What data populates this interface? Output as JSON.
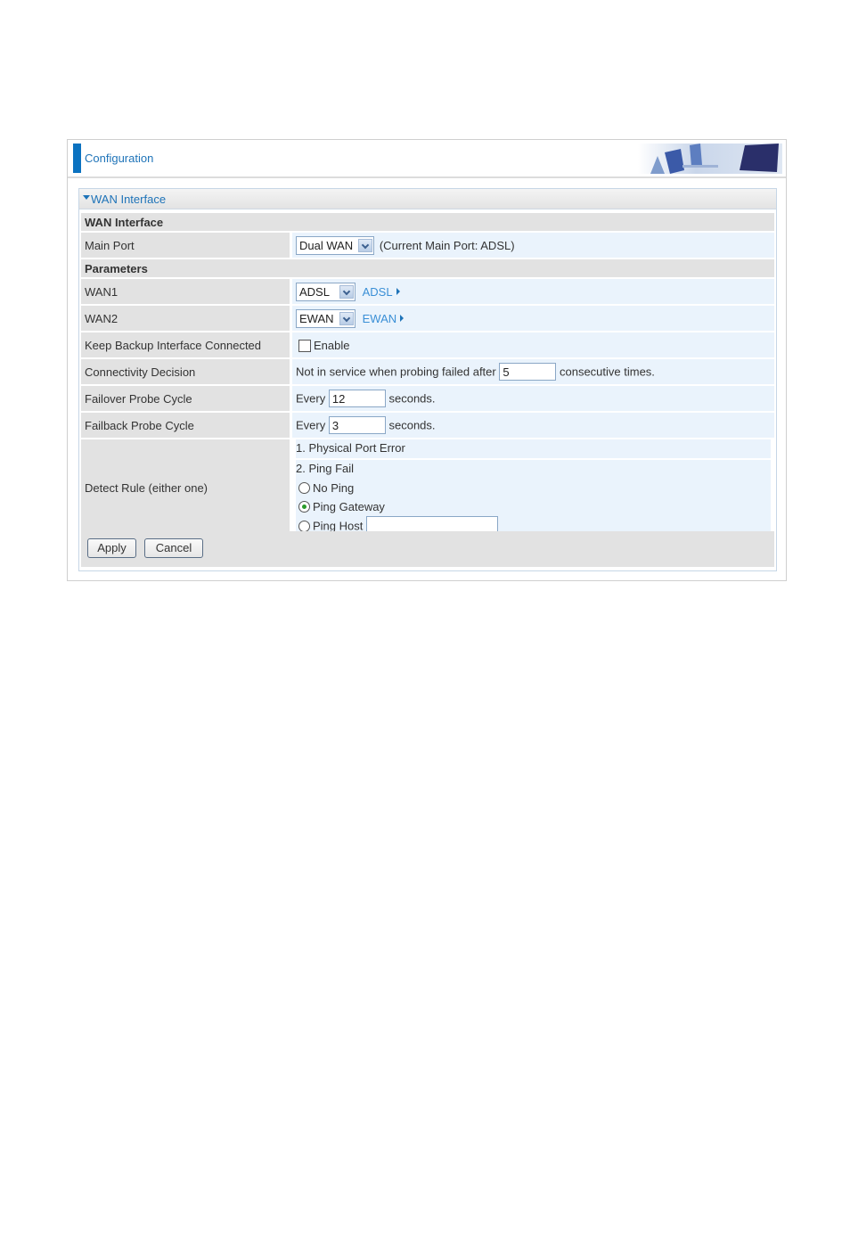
{
  "header": {
    "title": "Configuration",
    "banner_icon": "office-banner-image"
  },
  "panel": {
    "title": "WAN Interface"
  },
  "form": {
    "section1": "WAN Interface",
    "main_port": {
      "label": "Main Port",
      "selected": "Dual WAN",
      "note": "(Current Main Port: ADSL)"
    },
    "section2": "Parameters",
    "wan1": {
      "label": "WAN1",
      "selected": "ADSL",
      "link": "ADSL"
    },
    "wan2": {
      "label": "WAN2",
      "selected": "EWAN",
      "link": "EWAN"
    },
    "keep_backup": {
      "label": "Keep Backup Interface Connected",
      "checkbox_label": "Enable",
      "checked": false
    },
    "connectivity": {
      "label": "Connectivity Decision",
      "prefix": "Not in service when probing failed after",
      "value": "5",
      "suffix": "consecutive times."
    },
    "failover": {
      "label": "Failover Probe Cycle",
      "prefix": "Every",
      "value": "12",
      "suffix": "seconds."
    },
    "failback": {
      "label": "Failback Probe Cycle",
      "prefix": "Every",
      "value": "3",
      "suffix": "seconds."
    },
    "detect_rule": {
      "label": "Detect Rule (either one)",
      "rule1": "1. Physical Port Error",
      "rule2": "2. Ping Fail",
      "options": [
        {
          "label": "No Ping",
          "selected": false
        },
        {
          "label": "Ping Gateway",
          "selected": true
        },
        {
          "label": "Ping Host",
          "selected": false
        }
      ],
      "ping_host_value": ""
    }
  },
  "buttons": {
    "apply": "Apply",
    "cancel": "Cancel"
  }
}
